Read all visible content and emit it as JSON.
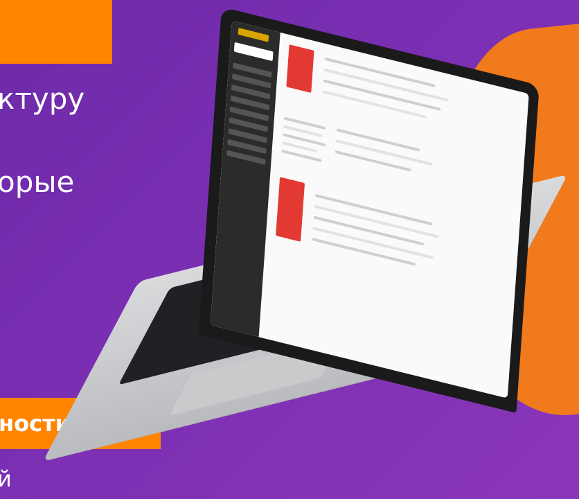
{
  "text": {
    "line1": "ктуру",
    "line2": "орые",
    "band": "ности",
    "line3": "й"
  },
  "colors": {
    "background": "#7b2fb3",
    "accent": "#ff8400",
    "blob": "#f07a1c",
    "card": "#e23a32"
  }
}
